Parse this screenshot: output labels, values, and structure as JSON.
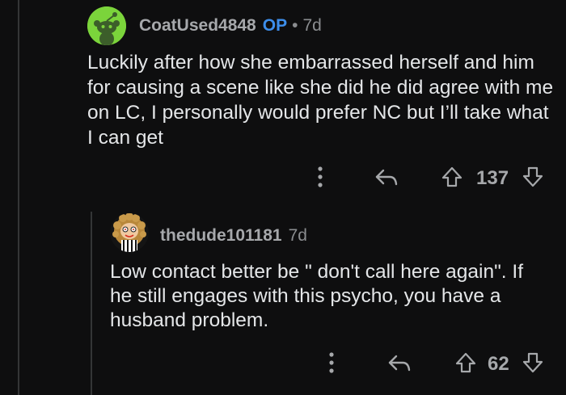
{
  "colors": {
    "background": "#0e0e0f",
    "op_badge": "#3d8eeb",
    "thread_line": "#343536"
  },
  "comments": [
    {
      "username": "CoatUsed4848",
      "op_badge": "OP",
      "separator": "•",
      "time": "7d",
      "body": "Luckily after how she embarrassed herself and him for causing a scene like she did he did agree with me on LC, I personally would prefer NC but I’ll take what I can get",
      "score": "137",
      "icons": [
        "snoo-avatar-icon",
        "more-options-icon",
        "reply-icon",
        "upvote-icon",
        "downvote-icon"
      ]
    },
    {
      "username": "thedude101181",
      "time": "7d",
      "body": "Low contact better be \" don't call here again\". If he still engages with this psycho, you have a husband problem.",
      "score": "62",
      "icons": [
        "user-avatar-icon",
        "more-options-icon",
        "reply-icon",
        "upvote-icon",
        "downvote-icon"
      ]
    }
  ]
}
